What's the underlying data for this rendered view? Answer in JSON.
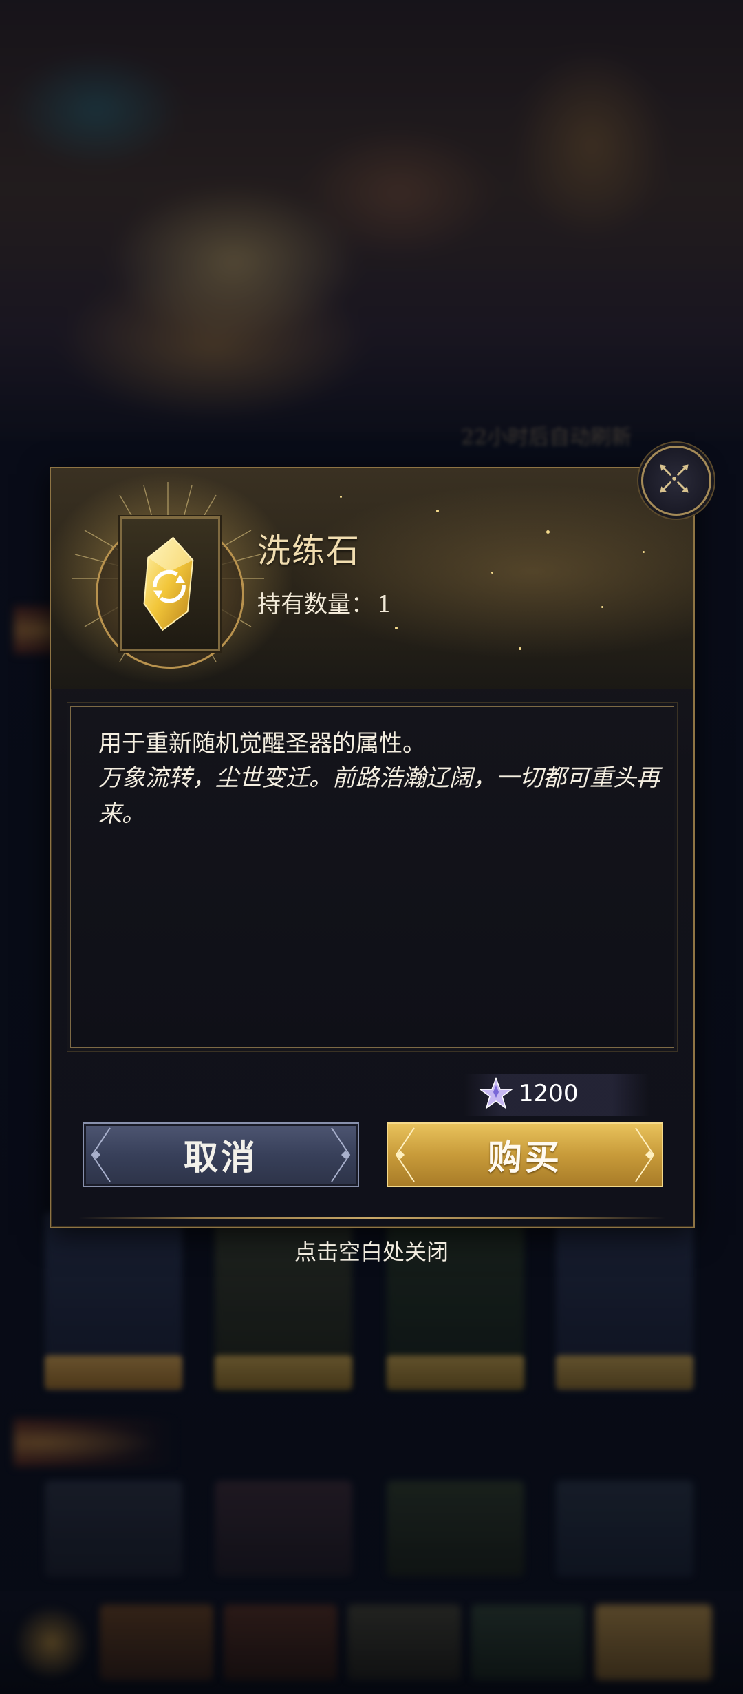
{
  "background": {
    "refresh_timer": "22小时后自动刷新"
  },
  "item": {
    "name": "洗练石",
    "count_label": "持有数量：",
    "count_value": "1",
    "icon": "refresh-crystal-icon"
  },
  "description": {
    "line1": "用于重新随机觉醒圣器的属性。",
    "line2": "万象流转，尘世变迁。前路浩瀚辽阔，一切都可重头再来。"
  },
  "price": {
    "currency_icon": "star-crystal-icon",
    "value": "1200"
  },
  "buttons": {
    "cancel_label": "取消",
    "buy_label": "购买"
  },
  "hint": "点击空白处关闭",
  "colors": {
    "gold_accent": "#c89b3a",
    "frame_gold": "#8e7444",
    "cancel_blue": "#38405a",
    "name_text": "#f1ddb0"
  }
}
